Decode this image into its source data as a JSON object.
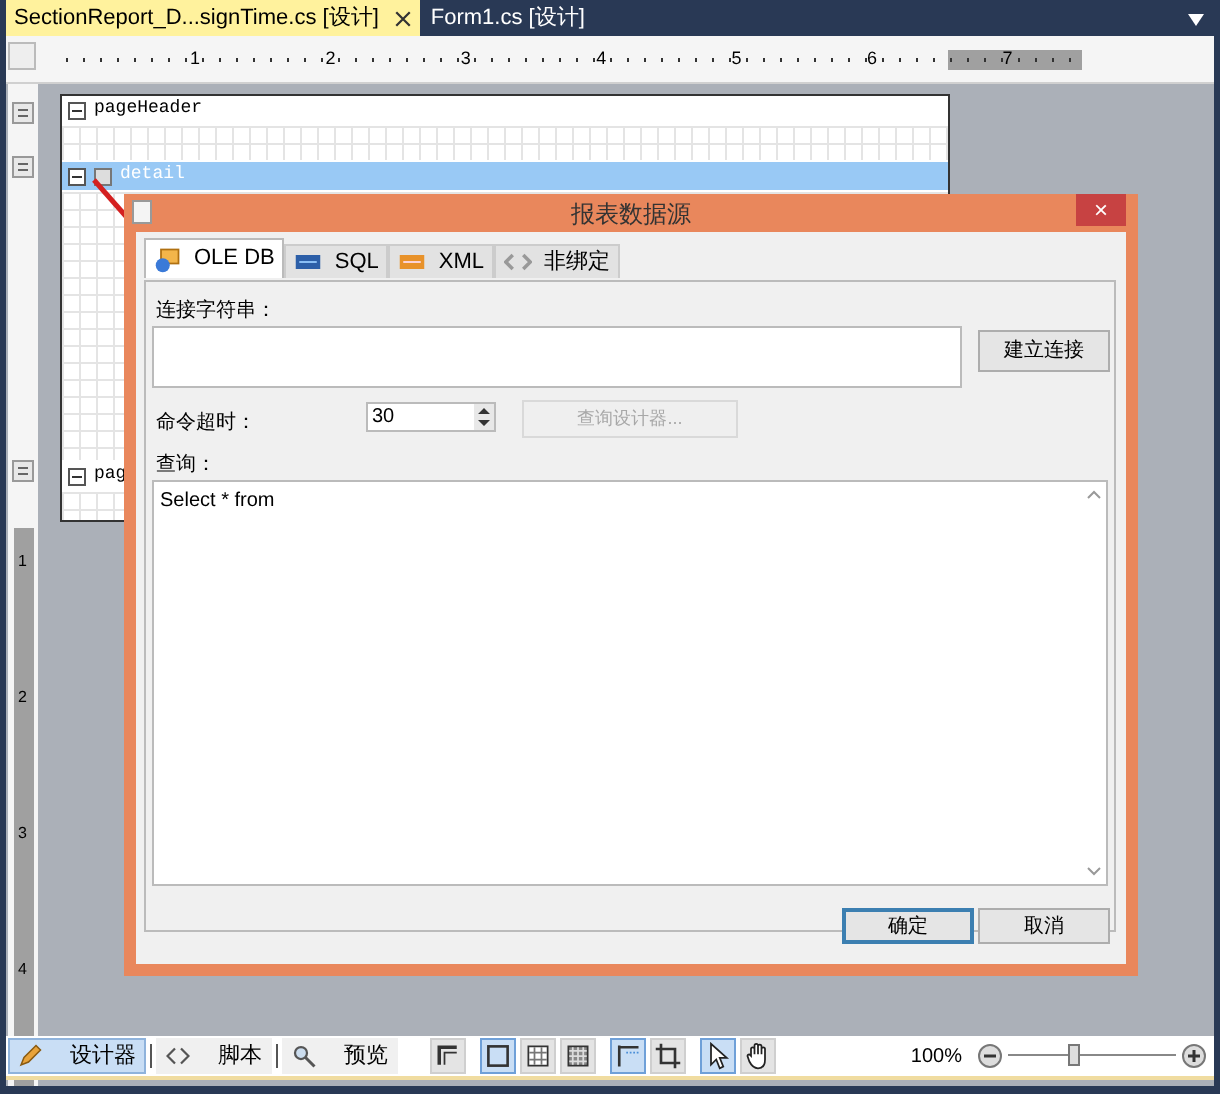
{
  "document_tabs": [
    {
      "label": "SectionReport_D...signTime.cs [设计]",
      "selected": true,
      "closable": true
    },
    {
      "label": "Form1.cs [设计]",
      "selected": false,
      "closable": false
    }
  ],
  "ruler": {
    "labels": [
      "1",
      "2",
      "3",
      "4",
      "5",
      "6",
      "7"
    ],
    "vertical_labels": [
      "1",
      "2",
      "3",
      "4"
    ]
  },
  "sections": [
    {
      "name": "pageHeader",
      "selected": false
    },
    {
      "name": "detail",
      "selected": true
    },
    {
      "name": "pag",
      "selected": false
    }
  ],
  "dialog": {
    "title": "报表数据源",
    "close": "×",
    "tabs": [
      {
        "label": "OLE DB",
        "selected": true
      },
      {
        "label": "SQL",
        "selected": false
      },
      {
        "label": "XML",
        "selected": false
      },
      {
        "label": "非绑定",
        "selected": false
      }
    ],
    "connection_label": "连接字符串：",
    "connect_button": "建立连接",
    "timeout_label": "命令超时：",
    "timeout_value": "30",
    "query_designer_button": {
      "label": "查询设计器...",
      "disabled": true
    },
    "query_label": "查询：",
    "query_value": "Select * from",
    "ok_button": {
      "label": "确定",
      "focused": true
    },
    "cancel_button": {
      "label": "取消",
      "focused": false
    }
  },
  "bottom_tabs": [
    {
      "label": "设计器",
      "selected": true,
      "kind": "designer"
    },
    {
      "label": "脚本",
      "selected": false,
      "kind": "script"
    },
    {
      "label": "预览",
      "selected": false,
      "kind": "preview"
    }
  ],
  "toolbar_toggles": [
    {
      "kind": "fit",
      "selected": false
    },
    {
      "kind": "box",
      "selected": true
    },
    {
      "kind": "grid",
      "selected": false
    },
    {
      "kind": "densegrid",
      "selected": false
    },
    {
      "kind": "snapline",
      "selected": true
    },
    {
      "kind": "snapgrid",
      "selected": false
    },
    {
      "kind": "pointer",
      "selected": true
    },
    {
      "kind": "hand",
      "selected": false
    }
  ],
  "zoom": {
    "value": "100%",
    "level": 0.38
  }
}
